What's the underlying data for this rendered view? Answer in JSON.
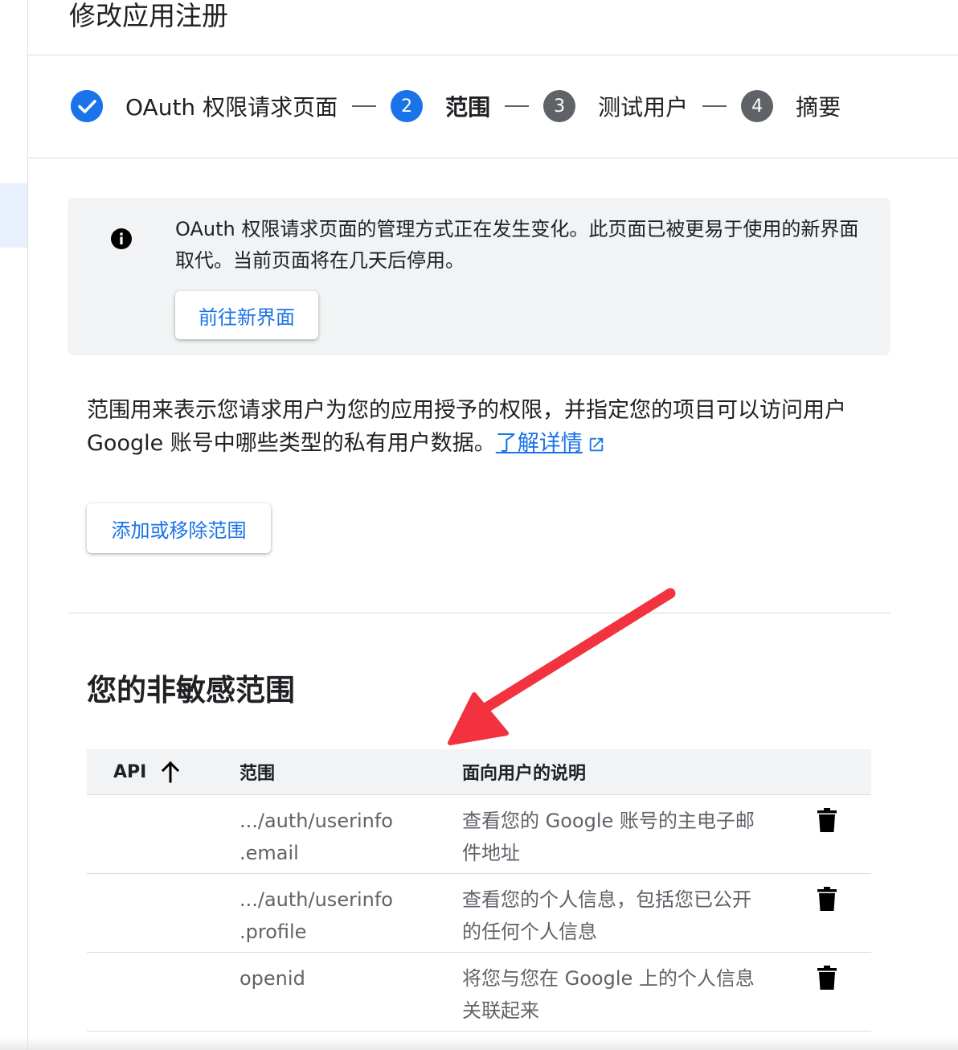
{
  "page": {
    "title": "修改应用注册"
  },
  "stepper": {
    "steps": [
      {
        "number": "",
        "label": "OAuth 权限请求页面",
        "state": "done"
      },
      {
        "number": "2",
        "label": "范围",
        "state": "active"
      },
      {
        "number": "3",
        "label": "测试用户",
        "state": "pending"
      },
      {
        "number": "4",
        "label": "摘要",
        "state": "pending"
      }
    ]
  },
  "notice": {
    "message": "OAuth 权限请求页面的管理方式正在发生变化。此页面已被更易于使用的新界面取代。当前页面将在几天后停用。",
    "button_label": "前往新界面"
  },
  "description": {
    "text": "范围用来表示您请求用户为您的应用授予的权限，并指定您的项目可以访问用户 Google 账号中哪些类型的私有用户数据。",
    "link_label": "了解详情"
  },
  "add_remove_button_label": "添加或移除范围",
  "non_sensitive": {
    "title": "您的非敏感范围",
    "columns": {
      "api": "API",
      "scope": "范围",
      "user_description": "面向用户的说明"
    },
    "rows": [
      {
        "api": "",
        "scope": ".../auth/userinfo\n.email",
        "scope_line1": ".../auth/userinfo",
        "scope_line2": ".email",
        "user_description": "查看您的 Google 账号的主电子邮件地址"
      },
      {
        "api": "",
        "scope_line1": ".../auth/userinfo",
        "scope_line2": ".profile",
        "user_description": "查看您的个人信息，包括您已公开的任何个人信息"
      },
      {
        "api": "",
        "scope_line1": "openid",
        "scope_line2": "",
        "user_description": "将您与您在 Google 上的个人信息关联起来"
      }
    ]
  },
  "colors": {
    "accent": "#1a73e8",
    "pending_step": "#5f6368",
    "annotation_arrow": "#f2333f"
  }
}
